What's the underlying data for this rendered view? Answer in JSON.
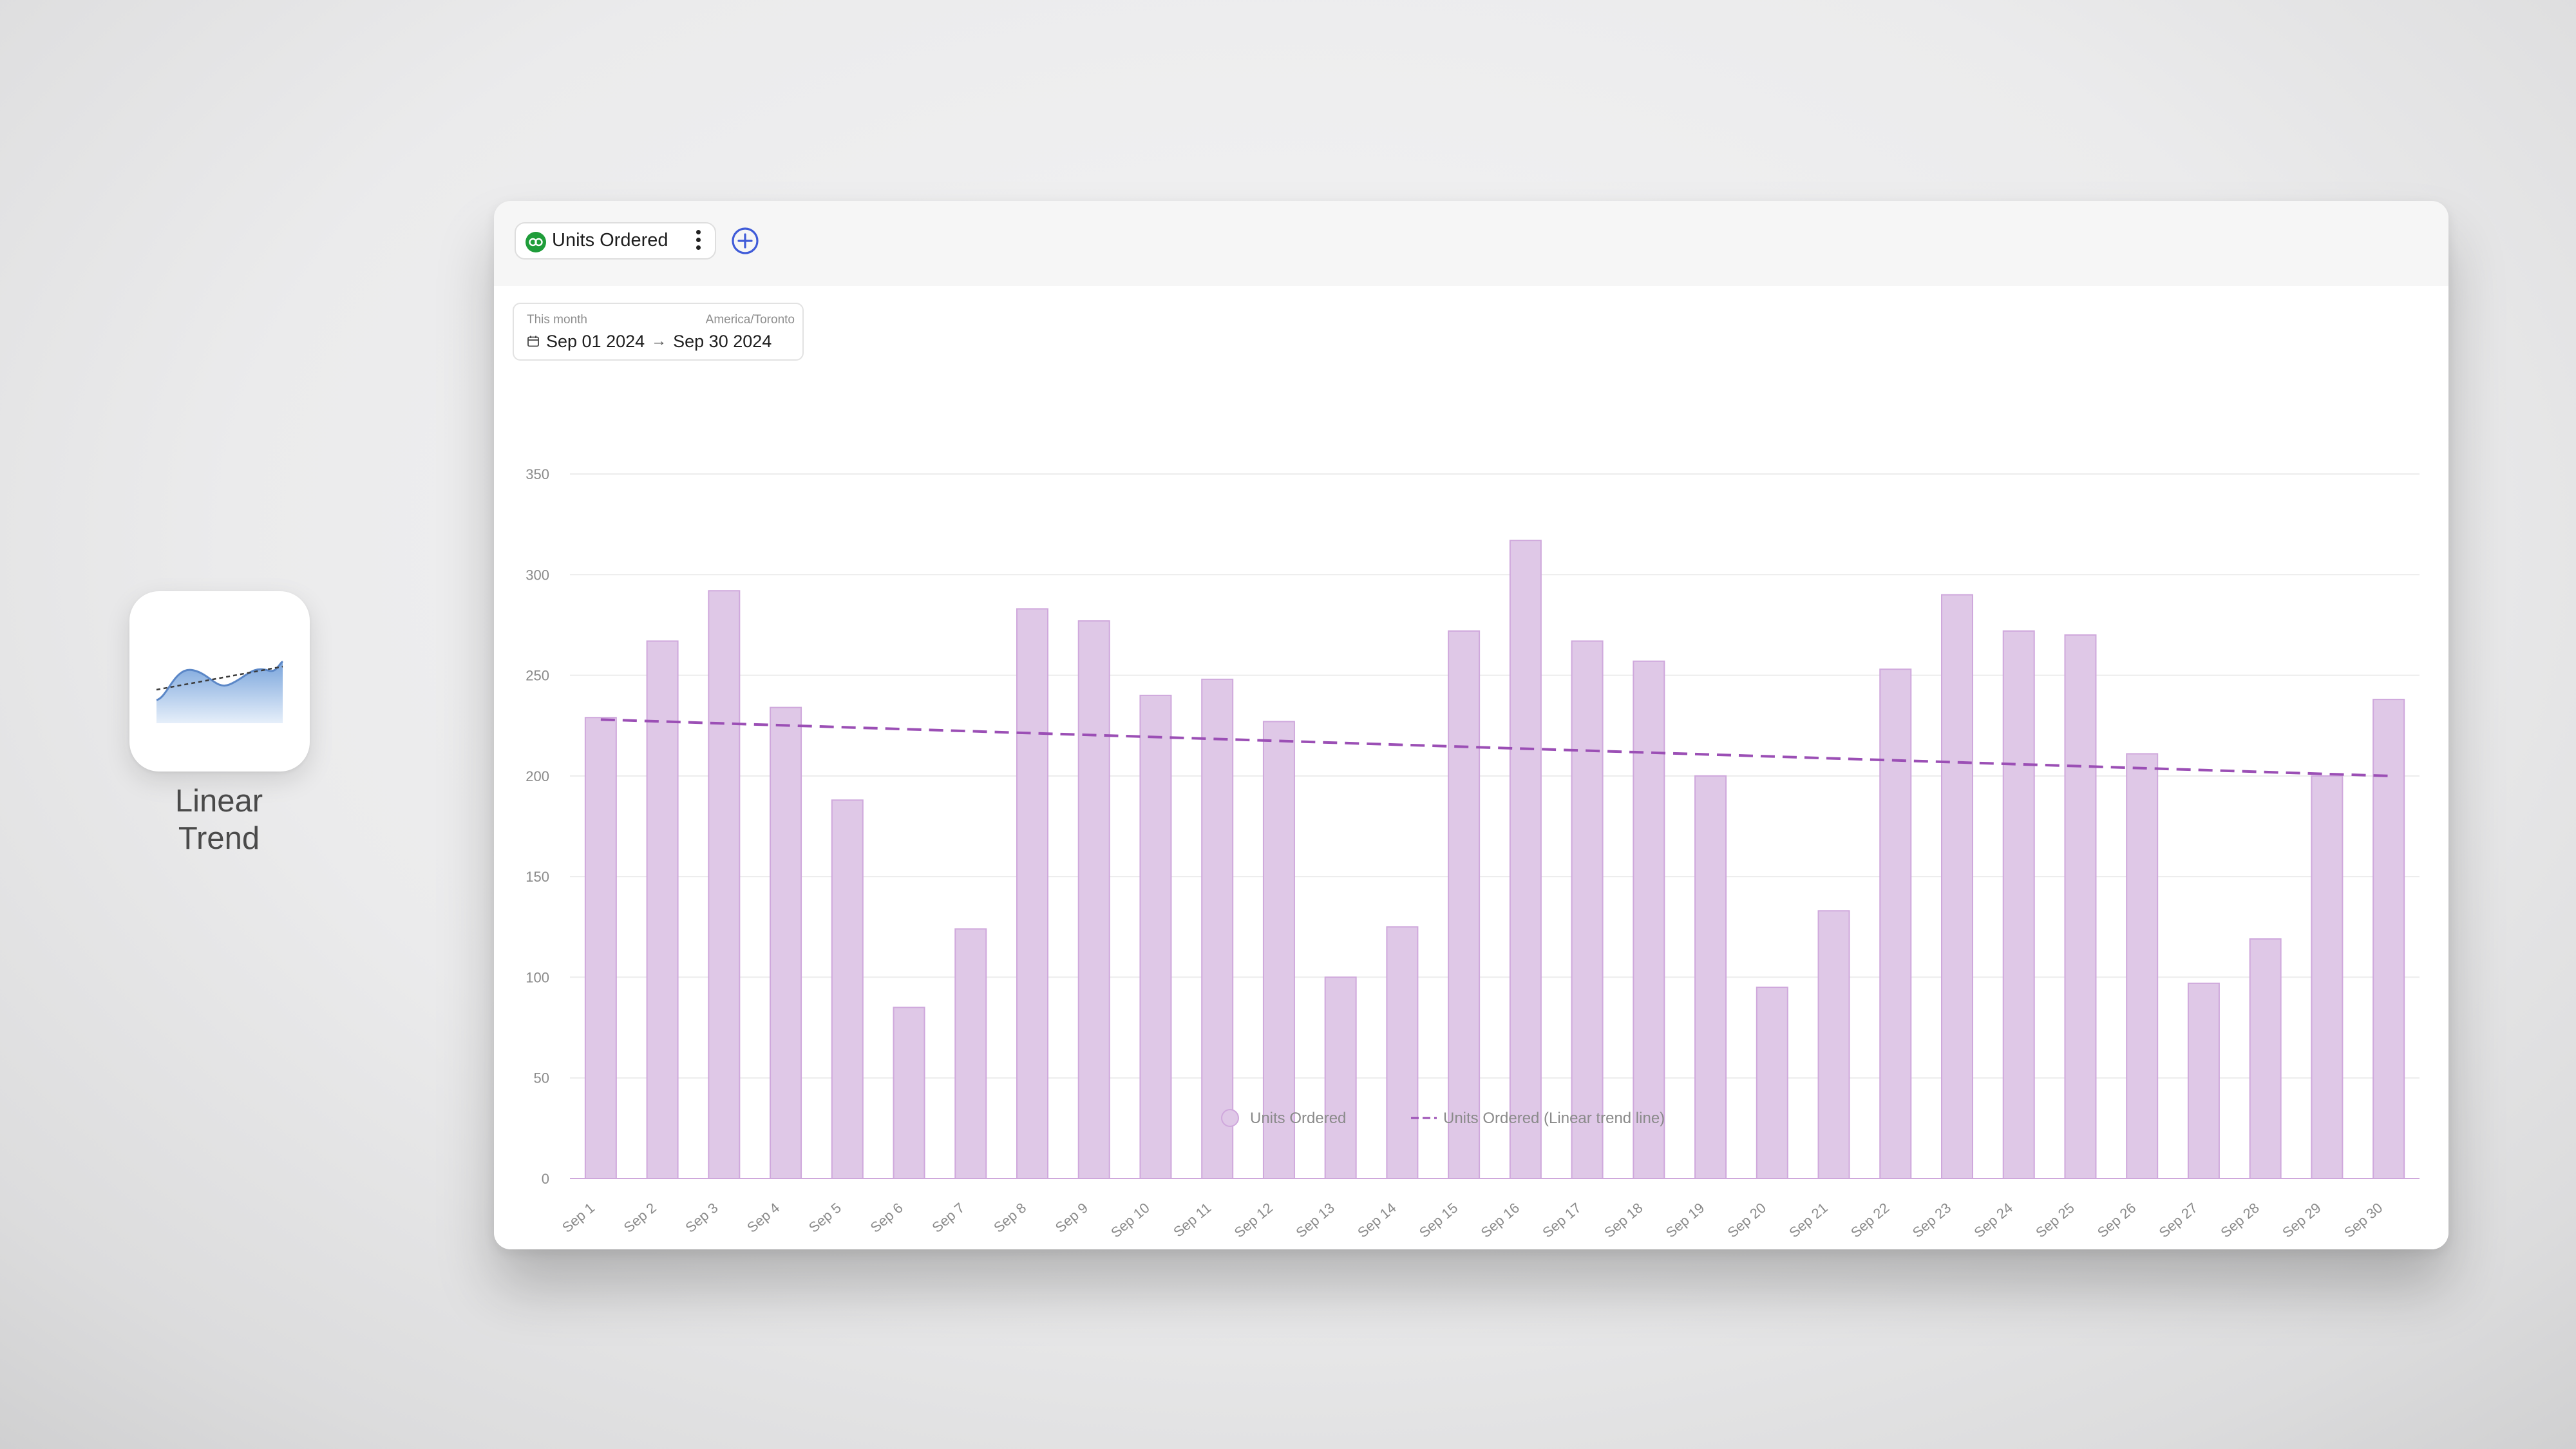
{
  "app": {
    "label_line1": "Linear",
    "label_line2": "Trend"
  },
  "toolbar": {
    "metric_label": "Units Ordered"
  },
  "date_range": {
    "caption": "This month",
    "timezone": "America/Toronto",
    "start": "Sep 01 2024",
    "end": "Sep 30 2024"
  },
  "colors": {
    "bar_fill": "#dfc8e7",
    "bar_stroke": "#cfa8dc",
    "trend": "#9b4fb5",
    "grid": "#ececec",
    "axis_text": "#8a8a8a"
  },
  "chart_data": {
    "type": "bar",
    "categories": [
      "Sep 1",
      "Sep 2",
      "Sep 3",
      "Sep 4",
      "Sep 5",
      "Sep 6",
      "Sep 7",
      "Sep 8",
      "Sep 9",
      "Sep 10",
      "Sep 11",
      "Sep 12",
      "Sep 13",
      "Sep 14",
      "Sep 15",
      "Sep 16",
      "Sep 17",
      "Sep 18",
      "Sep 19",
      "Sep 20",
      "Sep 21",
      "Sep 22",
      "Sep 23",
      "Sep 24",
      "Sep 25",
      "Sep 26",
      "Sep 27",
      "Sep 28",
      "Sep 29",
      "Sep 30"
    ],
    "series": [
      {
        "name": "Units Ordered",
        "values": [
          229,
          267,
          292,
          234,
          188,
          85,
          124,
          283,
          277,
          240,
          248,
          227,
          100,
          125,
          272,
          317,
          267,
          257,
          200,
          95,
          133,
          253,
          290,
          272,
          270,
          211,
          97,
          119,
          200,
          238
        ]
      }
    ],
    "trendline": {
      "name": "Units Ordered (Linear trend line)",
      "start": 228,
      "end": 200
    },
    "ylim": [
      0,
      350
    ],
    "yticks": [
      0,
      50,
      100,
      150,
      200,
      250,
      300,
      350
    ],
    "grid": true,
    "legend_position": "bottom-center"
  }
}
